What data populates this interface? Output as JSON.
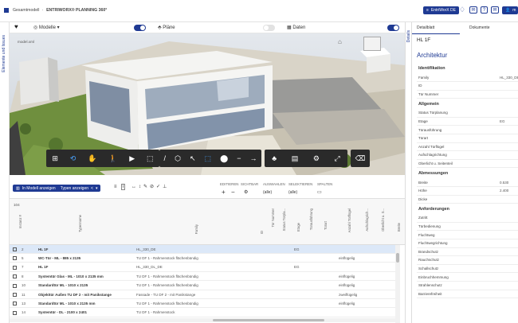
{
  "topbar": {
    "breadcrumb_root": "Gesamtmodell",
    "breadcrumb_sep": "·",
    "breadcrumb_app": "ENTRIWORX® PLANNING 360°",
    "user_button": "EntriWorX DE",
    "user_initial": "m"
  },
  "leftrail": {
    "label": "Elemente und Issues"
  },
  "rightrail": {
    "label": "Details"
  },
  "header": {
    "models_label": "Modelle",
    "plans_label": "Pläne",
    "data_label": "Daten",
    "models_on": true,
    "plans_on": false,
    "data_on": true
  },
  "viewport": {
    "corner_label": "model.xml"
  },
  "table_toolbar": {
    "show_in_model": "In Modell anzeigen",
    "types_show": "Typen anzeigen",
    "groups": [
      "EDITIEREN",
      "SICHTBAR",
      "AUSWAHLEN",
      "SELEKTIEREN",
      "SPALTEN"
    ],
    "select1": "(alle)",
    "select2": "(alle)"
  },
  "table": {
    "count": "104",
    "headers": {
      "instance": "Instanz #",
      "type": "Typenname",
      "family": "Family",
      "id": "ID",
      "tuer_nummer": "Tür Nummer",
      "status": "Status Türpla...",
      "etage": "Etage",
      "tuerausfuehrung": "Türausführung",
      "tuerart": "Türart",
      "anzahl": "Anzahl Türflügel",
      "aufschlag": "Aufschlagrich...",
      "oberlicht": "Oberlicht u. S...",
      "breite": "Breite"
    },
    "rows": [
      {
        "n": "2",
        "type": "HL 1F",
        "family": "HL_330_DE",
        "etage": "EG",
        "anzahl": "",
        "sel": true
      },
      {
        "n": "5",
        "type": "WC-Tür - ML - 885 x 2135",
        "family": "TU DF 1 - Rahmenstock flächenbündig",
        "etage": "",
        "anzahl": "einflügelig",
        "sel": false
      },
      {
        "n": "7",
        "type": "HL 1F",
        "family": "HL_330_DL_DE",
        "etage": "EG",
        "anzahl": "",
        "sel": false
      },
      {
        "n": "8",
        "type": "Systemtür Glas - ML - 1010 x 2135 mm",
        "family": "TU DF 1 - Rahmenstock flächenbündig",
        "etage": "",
        "anzahl": "einflügelig",
        "sel": false
      },
      {
        "n": "10",
        "type": "Standardtür ML - 1010 x 2135",
        "family": "TU DF 1 - Rahmenstock flächenbündig",
        "etage": "",
        "anzahl": "einflügelig",
        "sel": false
      },
      {
        "n": "11",
        "type": "Objekttür Außen TU DF 2 - mit Panikstange",
        "family": "Fassade - TU DF 2 - mit Panikstange",
        "etage": "",
        "anzahl": "zweiflügelig",
        "sel": false
      },
      {
        "n": "13",
        "type": "Standardtür ML - 1010 x 2135 mm",
        "family": "TU DF 1 - Rahmenstock flächenbündig",
        "etage": "",
        "anzahl": "einflügelig",
        "sel": false
      },
      {
        "n": "14",
        "type": "Systemtür - DL - 2100 x 2401",
        "family": "TU DF 1 - Rahmenstock",
        "etage": "",
        "anzahl": "",
        "sel": false
      }
    ]
  },
  "panel": {
    "tab_details": "Detailblatt",
    "tab_docs": "Dokumente",
    "title": "HL 1F",
    "heading": "Architektur",
    "sections": [
      {
        "title": "Identifikation",
        "props": [
          [
            "Family",
            "HL_330_DE"
          ],
          [
            "ID",
            ""
          ],
          [
            "Tür Nummer",
            ""
          ]
        ]
      },
      {
        "title": "Allgemein",
        "props": [
          [
            "Status Türplanung",
            ""
          ],
          [
            "Etage",
            "EG"
          ],
          [
            "Türausführung",
            ""
          ],
          [
            "Türart",
            ""
          ],
          [
            "Anzahl Türflügel",
            ""
          ],
          [
            "Aufschlagrichtung",
            ""
          ],
          [
            "Oberlicht u. Seitenteil",
            ""
          ]
        ]
      },
      {
        "title": "Abmessungen",
        "props": [
          [
            "Breite",
            "0.530"
          ],
          [
            "Höhe",
            "2.400"
          ],
          [
            "Dicke",
            ""
          ]
        ]
      },
      {
        "title": "Anforderungen",
        "props": [
          [
            "Zutritt",
            ""
          ],
          [
            "Türbedienung",
            ""
          ],
          [
            "Fluchtweg",
            ""
          ],
          [
            "Fluchtwegrichtung",
            ""
          ],
          [
            "Brandschutz",
            ""
          ],
          [
            "Rauchschutz",
            ""
          ],
          [
            "Schallschutz",
            ""
          ],
          [
            "Einbruchhemmung",
            ""
          ],
          [
            "Strahlenschutz",
            ""
          ],
          [
            "Barrierefreiheit",
            ""
          ]
        ]
      }
    ]
  },
  "colors": {
    "brand": "#1f3a93",
    "selected_row": "#dce8f8",
    "toolbar": "#2a2a2a"
  }
}
